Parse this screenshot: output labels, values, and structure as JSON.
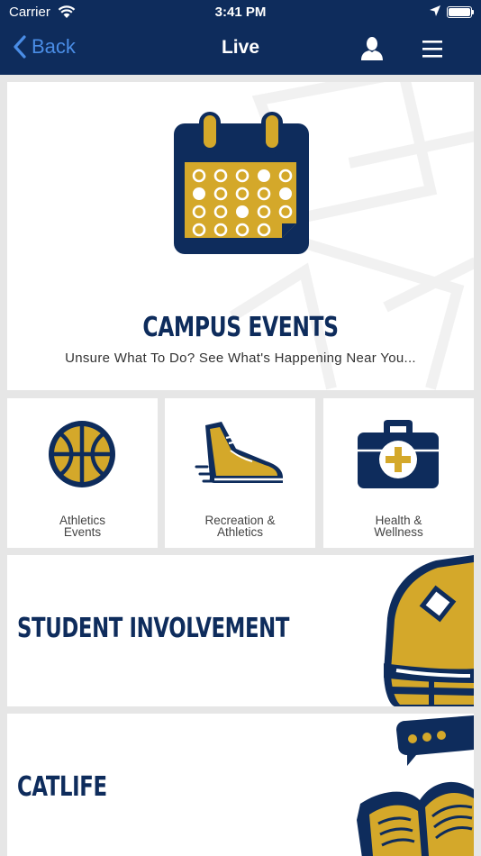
{
  "status_bar": {
    "carrier": "Carrier",
    "time": "3:41 PM"
  },
  "nav": {
    "back_label": "Back",
    "title": "Live"
  },
  "hero": {
    "title": "CAMPUS EVENTS",
    "subtitle": "Unsure What To Do? See What's Happening Near You..."
  },
  "tiles": [
    {
      "label": "Athletics\nEvents",
      "icon": "basketball-icon"
    },
    {
      "label": "Recreation &\nAthletics",
      "icon": "sneaker-icon"
    },
    {
      "label": "Health &\nWellness",
      "icon": "medical-bag-icon"
    }
  ],
  "banners": [
    {
      "title": "STUDENT INVOLVEMENT",
      "icon": "backpack-icon"
    },
    {
      "title": "CATLIFE",
      "icon": "book-chat-icon"
    }
  ],
  "colors": {
    "navy": "#0e2c5c",
    "gold": "#d4a82a",
    "link_blue": "#4a8de6",
    "background": "#e6e6e6"
  }
}
